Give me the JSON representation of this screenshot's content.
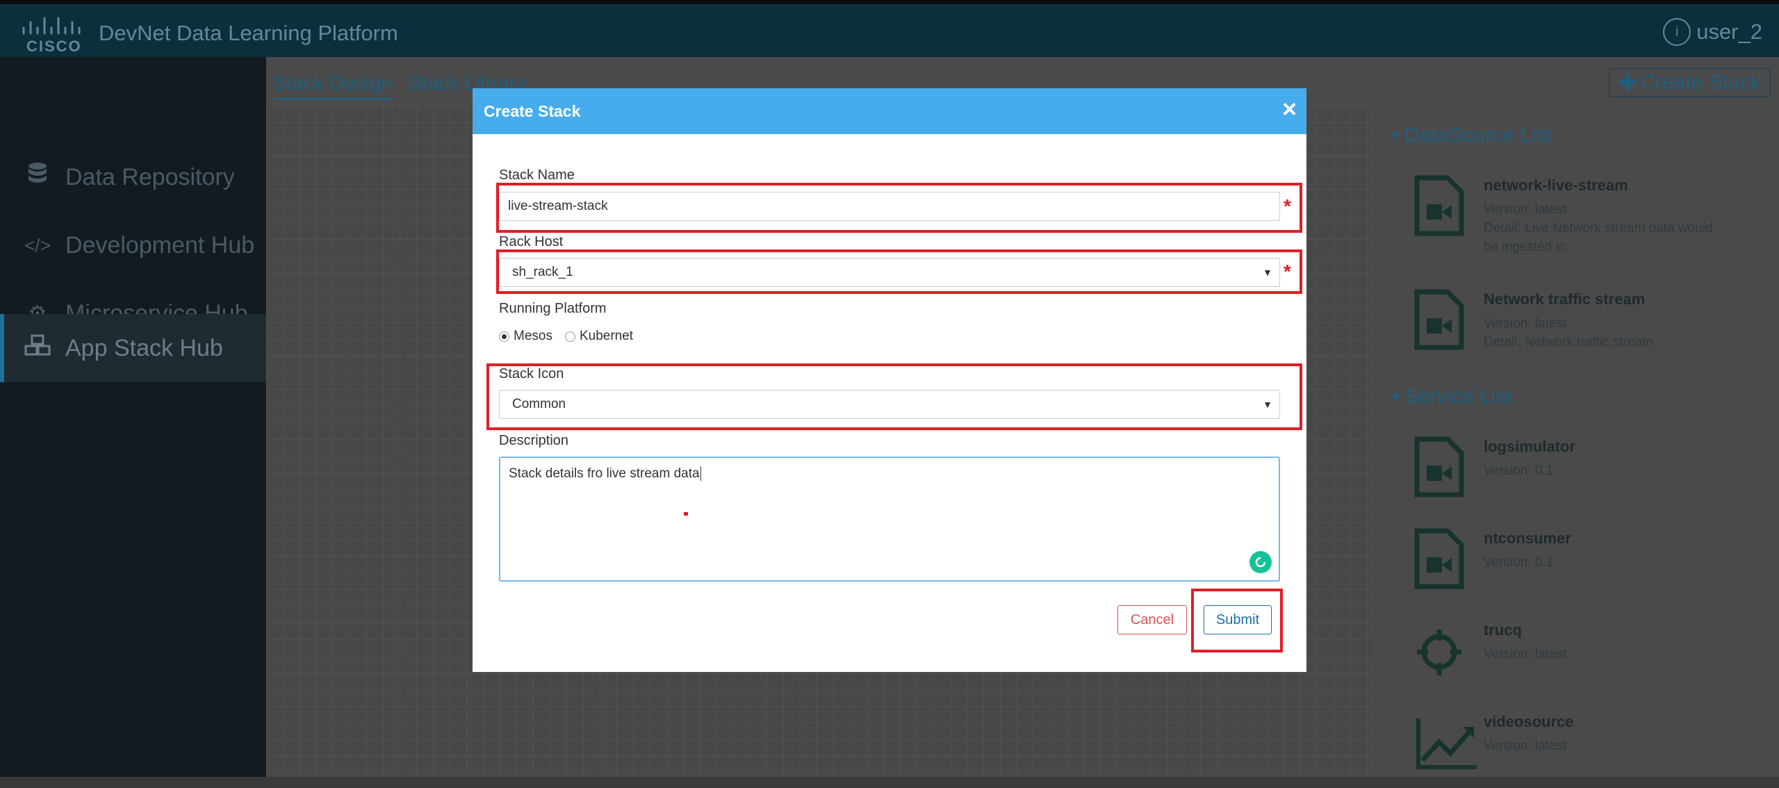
{
  "app": {
    "title": "DevNet Data Learning Platform",
    "user": "user_2"
  },
  "sidebar": {
    "items": [
      {
        "label": "Data Repository",
        "icon": "database-icon"
      },
      {
        "label": "Development Hub",
        "icon": "code-icon"
      },
      {
        "label": "Microservice Hub",
        "icon": "gears-icon"
      },
      {
        "label": "App Stack Hub",
        "icon": "cubes-icon",
        "active": true
      }
    ]
  },
  "main": {
    "tabs": [
      {
        "label": "Stack Design",
        "active": true
      },
      {
        "label": "Stack Library"
      }
    ],
    "create_stack_label": "Create Stack"
  },
  "right_panel": {
    "datasource_title": "DataSource List",
    "datasources": [
      {
        "name": "network-live-stream",
        "version": "Version: latest",
        "detail": "Detail: Live Network stream data would be ingested in"
      },
      {
        "name": "Network traffic stream",
        "version": "Version: latest",
        "detail": "Detail: Network traffic stream"
      }
    ],
    "service_title": "Service List",
    "services": [
      {
        "name": "logsimulator",
        "version": "Version: 0.1",
        "icon": "video-file-icon"
      },
      {
        "name": "ntconsumer",
        "version": "Version: 0.1",
        "icon": "video-file-icon"
      },
      {
        "name": "trucq",
        "version": "Version: latest",
        "icon": "crosshair-icon"
      },
      {
        "name": "videosource",
        "version": "Version: latest",
        "icon": "trend-chart-icon"
      }
    ]
  },
  "modal": {
    "title": "Create Stack",
    "stack_name_label": "Stack Name",
    "stack_name_value": "live-stream-stack",
    "rack_host_label": "Rack Host",
    "rack_host_value": "sh_rack_1",
    "platform_label": "Running Platform",
    "platform_options": [
      {
        "label": "Mesos",
        "selected": true
      },
      {
        "label": "Kubernet",
        "selected": false
      }
    ],
    "stack_icon_label": "Stack Icon",
    "stack_icon_value": "Common",
    "description_label": "Description",
    "description_value": "Stack details fro live stream data",
    "cancel_label": "Cancel",
    "submit_label": "Submit",
    "required_mark": "*"
  },
  "colors": {
    "header_blue": "#46aceb",
    "highlight_red": "#e01e25",
    "accent": "#1e5f7f"
  }
}
